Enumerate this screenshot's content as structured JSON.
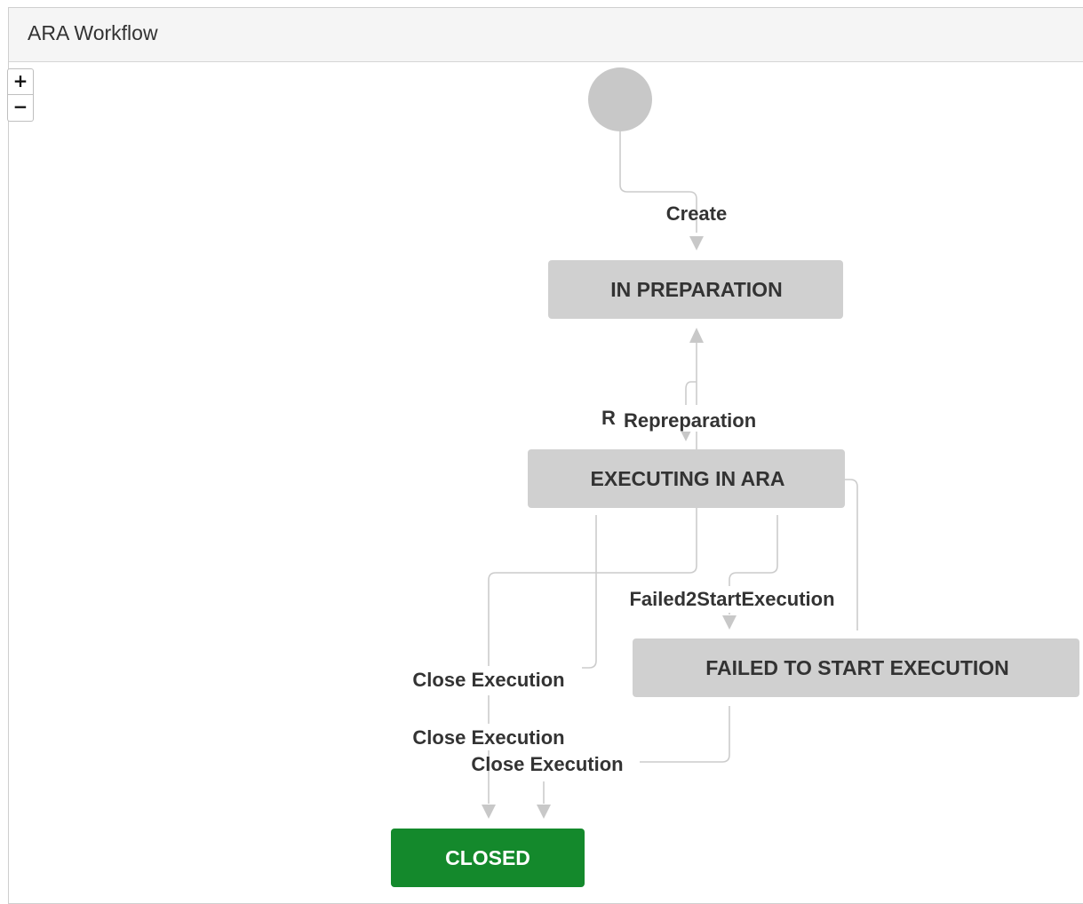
{
  "panel": {
    "title": "ARA Workflow"
  },
  "zoom": {
    "in_label": "+",
    "out_label": "−"
  },
  "colors": {
    "status_node": "#d0d0d0",
    "closed_node": "#14892c",
    "start_node": "#c8c8c8",
    "edge": "#cccccc"
  },
  "statuses": {
    "in_preparation": "IN PREPARATION",
    "executing_in_ara": "EXECUTING IN ARA",
    "failed_to_start_execution": "FAILED TO START EXECUTION",
    "closed": "CLOSED"
  },
  "transitions": {
    "create": "Create",
    "repreparation_hidden": "R",
    "repreparation": "Repreparation",
    "failed2startexecution": "Failed2StartExecution",
    "close_execution_1": "Close Execution",
    "close_execution_2": "Close Execution",
    "close_execution_3": "Close Execution"
  }
}
